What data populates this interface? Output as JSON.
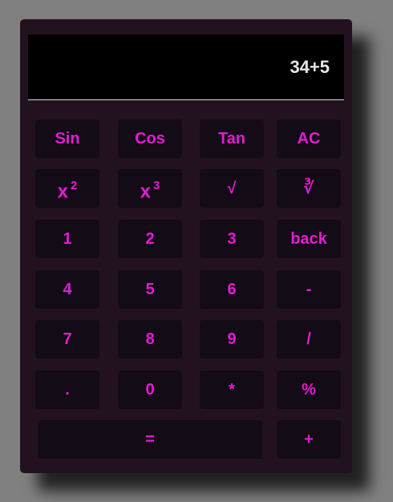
{
  "display": {
    "value": "34+5"
  },
  "buttons": {
    "sin": "Sin",
    "cos": "Cos",
    "tan": "Tan",
    "ac": "AC",
    "square_base": "x",
    "square_exp": "2",
    "cube_base": "x",
    "cube_exp": "3",
    "sqrt": "√",
    "cbrt": "∛",
    "one": "1",
    "two": "2",
    "three": "3",
    "back": "back",
    "four": "4",
    "five": "5",
    "six": "6",
    "minus": "-",
    "seven": "7",
    "eight": "8",
    "nine": "9",
    "divide": "/",
    "dot": ".",
    "zero": "0",
    "multiply": "*",
    "percent": "%",
    "equals": "=",
    "plus": "+"
  },
  "colors": {
    "page_background": "#808080",
    "calculator_body": "#22121f",
    "display_background": "#000000",
    "display_text": "#e6e6e6",
    "button_background": "#130b16",
    "button_text": "#e31bd5"
  }
}
